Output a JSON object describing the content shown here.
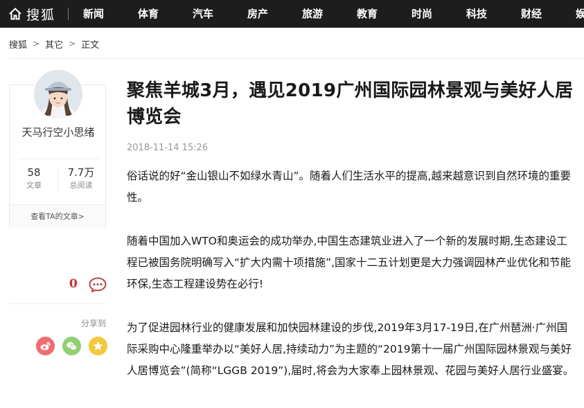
{
  "header": {
    "logo_text": "搜狐",
    "home_icon": "home-icon",
    "nav": [
      "新闻",
      "体育",
      "汽车",
      "房产",
      "旅游",
      "教育",
      "时尚",
      "科技",
      "财经",
      "娱"
    ]
  },
  "breadcrumb": {
    "items": [
      "搜狐",
      "其它",
      "正文"
    ],
    "separator": ">"
  },
  "author": {
    "name": "天马行空小思绪",
    "articles_count": "58",
    "articles_label": "文章",
    "reads_count": "7.7万",
    "reads_label": "总阅读",
    "view_link": "查看TA的文章>"
  },
  "engagement": {
    "comment_count": "0",
    "share_label": "分享到",
    "share_icons": [
      "weibo-icon",
      "wechat-icon",
      "qzone-icon"
    ]
  },
  "article": {
    "title": "聚焦羊城3月，遇见2019广州国际园林景观与美好人居博览会",
    "date": "2018-11-14 15:26",
    "paragraphs": [
      "俗话说的好“金山银山不如绿水青山”。随着人们生活水平的提高,越来越意识到自然环境的重要性。",
      "随着中国加入WTO和奥运会的成功举办,中国生态建筑业进入了一个新的发展时期,生态建设工程已被国务院明确写入“扩大内需十项措施”,国家十二五计划更是大力强调园林产业优化和节能环保,生态工程建设势在必行!",
      "为了促进园林行业的健康发展和加快园林建设的步伐,2019年3月17-19日,在广州琶洲·广州国际采购中心隆重举办以“美好人居,持续动力”为主题的“2019第十一届广州国际园林景观与美好人居博览会”(简称“LGGB 2019”),届时,将会为大家奉上园林景观、花园与美好人居行业盛宴。"
    ]
  },
  "colors": {
    "topbar": "#1d1d1d",
    "comment_red": "#d7282a",
    "weibo": "#f36b6b",
    "wechat": "#8fd16f",
    "qzone": "#f5c936"
  }
}
